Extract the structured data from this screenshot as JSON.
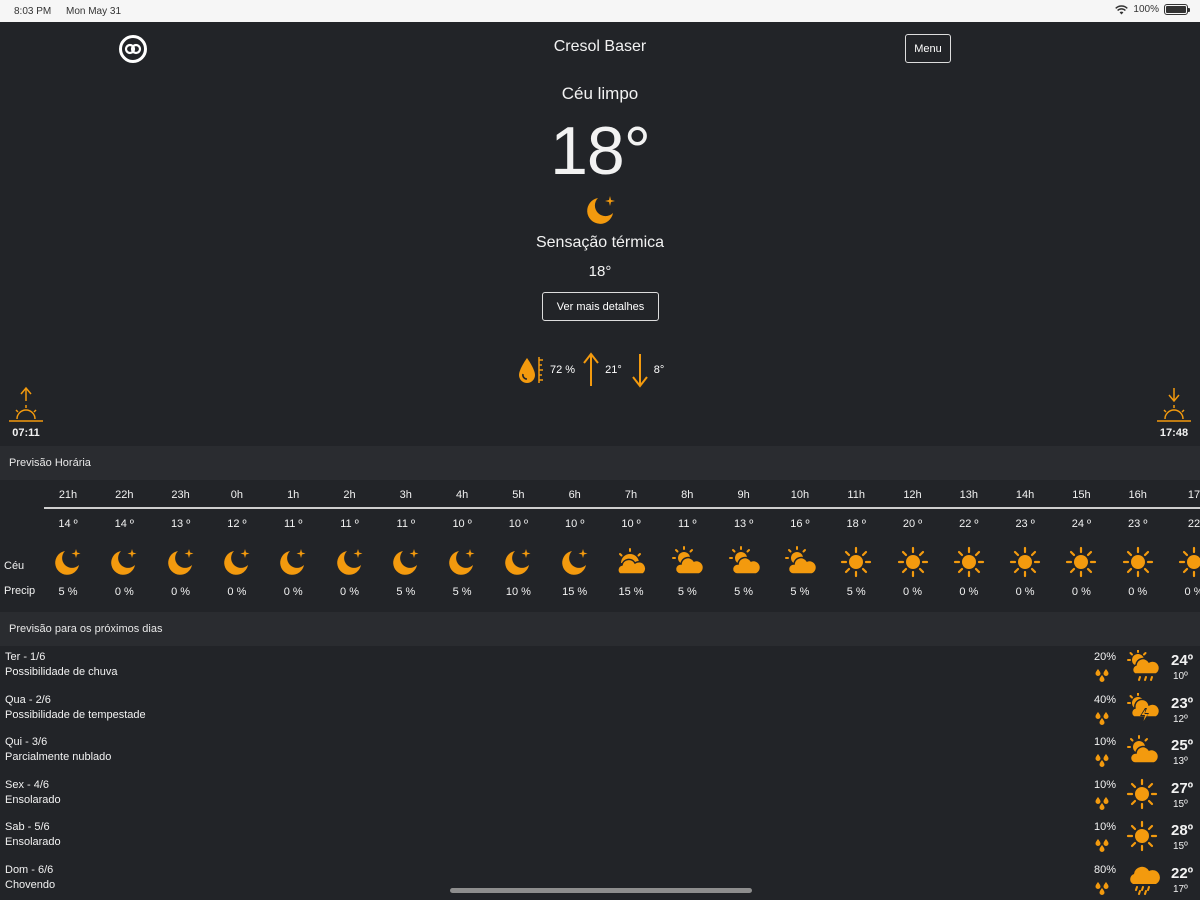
{
  "status_bar": {
    "time": "8:03 PM",
    "date": "Mon May 31",
    "battery": "100%"
  },
  "header": {
    "title": "Cresol Baser",
    "menu_label": "Menu"
  },
  "current": {
    "condition": "Céu limpo",
    "temperature": "18°",
    "icon": "moon-icon",
    "feels_like_label": "Sensação térmica",
    "feels_like_value": "18°",
    "details_button": "Ver mais detalhes",
    "humidity": "72 %",
    "max": "21°",
    "min": "8°",
    "sunrise": "07:11",
    "sunset": "17:48"
  },
  "hourly": {
    "title": "Previsão Horária",
    "row_labels": {
      "sky": "Céu",
      "precip": "Precip"
    },
    "items": [
      {
        "hour": "21h",
        "temp": "14 º",
        "icon": "moon",
        "precip": "5 %"
      },
      {
        "hour": "22h",
        "temp": "14 º",
        "icon": "moon",
        "precip": "0 %"
      },
      {
        "hour": "23h",
        "temp": "13 º",
        "icon": "moon",
        "precip": "0 %"
      },
      {
        "hour": "0h",
        "temp": "12 º",
        "icon": "moon",
        "precip": "0 %"
      },
      {
        "hour": "1h",
        "temp": "11 º",
        "icon": "moon",
        "precip": "0 %"
      },
      {
        "hour": "2h",
        "temp": "11 º",
        "icon": "moon",
        "precip": "0 %"
      },
      {
        "hour": "3h",
        "temp": "11 º",
        "icon": "moon",
        "precip": "5 %"
      },
      {
        "hour": "4h",
        "temp": "10 º",
        "icon": "moon",
        "precip": "5 %"
      },
      {
        "hour": "5h",
        "temp": "10 º",
        "icon": "moon",
        "precip": "10 %"
      },
      {
        "hour": "6h",
        "temp": "10 º",
        "icon": "moon",
        "precip": "15 %"
      },
      {
        "hour": "7h",
        "temp": "10 º",
        "icon": "sunrise-cloud",
        "precip": "15 %"
      },
      {
        "hour": "8h",
        "temp": "11 º",
        "icon": "partly-cloudy",
        "precip": "5 %"
      },
      {
        "hour": "9h",
        "temp": "13 º",
        "icon": "partly-cloudy",
        "precip": "5 %"
      },
      {
        "hour": "10h",
        "temp": "16 º",
        "icon": "partly-cloudy",
        "precip": "5 %"
      },
      {
        "hour": "11h",
        "temp": "18 º",
        "icon": "sun",
        "precip": "5 %"
      },
      {
        "hour": "12h",
        "temp": "20 º",
        "icon": "sun",
        "precip": "0 %"
      },
      {
        "hour": "13h",
        "temp": "22 º",
        "icon": "sun",
        "precip": "0 %"
      },
      {
        "hour": "14h",
        "temp": "23 º",
        "icon": "sun",
        "precip": "0 %"
      },
      {
        "hour": "15h",
        "temp": "24 º",
        "icon": "sun",
        "precip": "0 %"
      },
      {
        "hour": "16h",
        "temp": "23 º",
        "icon": "sun",
        "precip": "0 %"
      },
      {
        "hour": "17",
        "temp": "22",
        "icon": "sun",
        "precip": "0 %"
      }
    ]
  },
  "daily": {
    "title": "Previsão para os próximos dias",
    "items": [
      {
        "day": "Ter - 1/6",
        "desc": "Possibilidade de chuva",
        "pct": "20%",
        "icon": "sun-cloud-rain",
        "max": "24º",
        "min": "10º"
      },
      {
        "day": "Qua - 2/6",
        "desc": "Possibilidade de tempestade",
        "pct": "40%",
        "icon": "storm",
        "max": "23º",
        "min": "12º"
      },
      {
        "day": "Qui - 3/6",
        "desc": "Parcialmente nublado",
        "pct": "10%",
        "icon": "partly-cloudy",
        "max": "25º",
        "min": "13º"
      },
      {
        "day": "Sex - 4/6",
        "desc": "Ensolarado",
        "pct": "10%",
        "icon": "sun",
        "max": "27º",
        "min": "15º"
      },
      {
        "day": "Sab - 5/6",
        "desc": "Ensolarado",
        "pct": "10%",
        "icon": "sun",
        "max": "28º",
        "min": "15º"
      },
      {
        "day": "Dom - 6/6",
        "desc": "Chovendo",
        "pct": "80%",
        "icon": "rain",
        "max": "22º",
        "min": "17º"
      }
    ]
  },
  "colors": {
    "accent": "#F39A0E",
    "background": "#222428",
    "section_header": "#2A2C30"
  }
}
